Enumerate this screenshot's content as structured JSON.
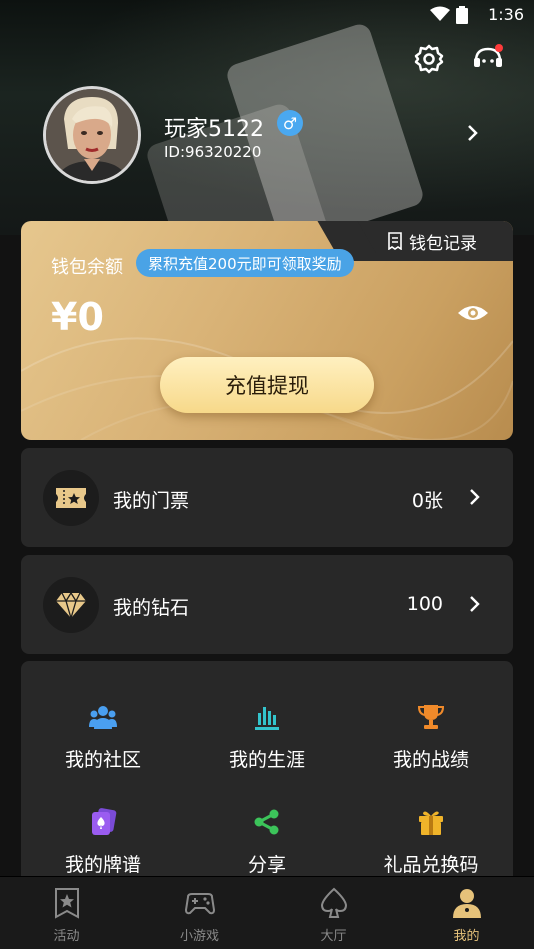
{
  "status_bar": {
    "time": "1:36"
  },
  "profile": {
    "username": "玩家5122",
    "gender_symbol": "♂",
    "user_id": "ID:96320220"
  },
  "wallet": {
    "record_label": "钱包记录",
    "balance_label": "钱包余额",
    "promo_text": "累积充值200元即可领取奖励",
    "balance": "¥0",
    "recharge_button": "充值提现"
  },
  "tickets": {
    "label": "我的门票",
    "value": "0张"
  },
  "diamonds": {
    "label": "我的钻石",
    "value": "100"
  },
  "grid": [
    {
      "label": "我的社区",
      "icon": "community-icon"
    },
    {
      "label": "我的生涯",
      "icon": "career-chart-icon"
    },
    {
      "label": "我的战绩",
      "icon": "trophy-icon"
    },
    {
      "label": "我的牌谱",
      "icon": "card-record-icon"
    },
    {
      "label": "分享",
      "icon": "share-icon"
    },
    {
      "label": "礼品兑换码",
      "icon": "gift-icon"
    }
  ],
  "bottom_nav": [
    {
      "label": "活动",
      "icon": "activity-star-icon"
    },
    {
      "label": "小游戏",
      "icon": "gamepad-icon"
    },
    {
      "label": "大厅",
      "icon": "spade-icon"
    },
    {
      "label": "我的",
      "icon": "person-icon"
    }
  ],
  "colors": {
    "accent_gold": "#e6c27a",
    "promo_blue": "#4aa3e6",
    "card_bg": "#282828"
  }
}
